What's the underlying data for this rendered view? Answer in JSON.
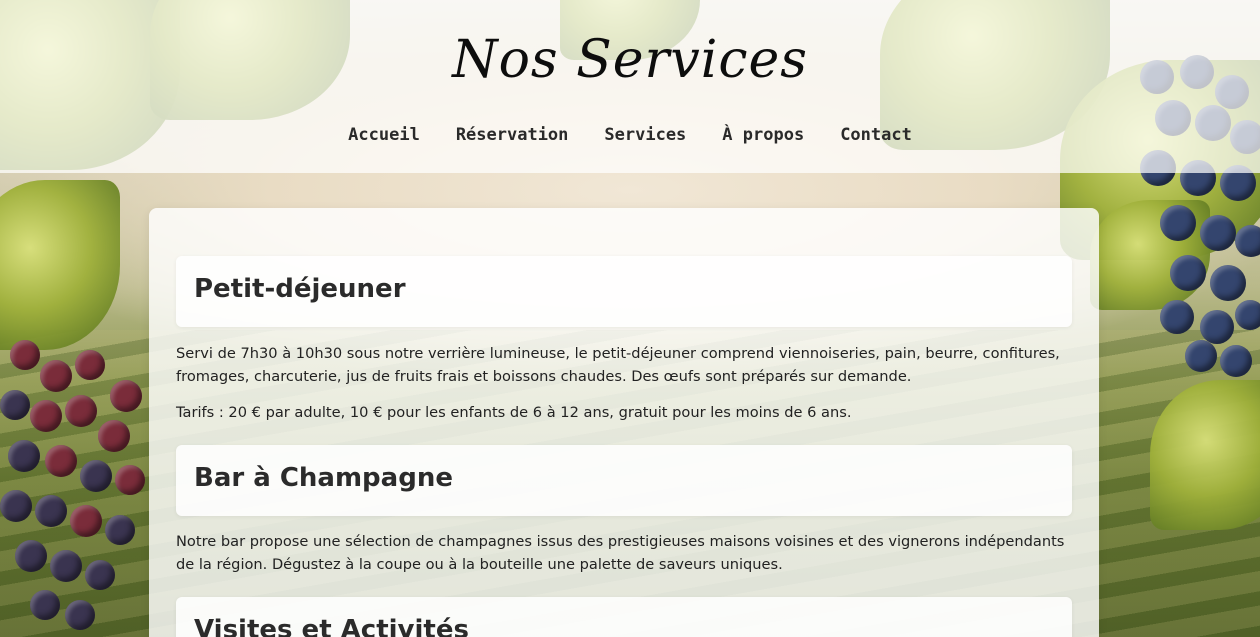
{
  "header": {
    "title": "Nos Services",
    "nav": [
      {
        "label": "Accueil"
      },
      {
        "label": "Réservation"
      },
      {
        "label": "Services"
      },
      {
        "label": "À propos"
      },
      {
        "label": "Contact"
      }
    ]
  },
  "sections": [
    {
      "title": "Petit-déjeuner",
      "paragraphs": [
        "Servi de 7h30 à 10h30 sous notre verrière lumineuse, le petit-déjeuner comprend viennoiseries, pain, beurre, confitures, fromages, charcuterie, jus de fruits frais et boissons chaudes. Des œufs sont préparés sur demande.",
        "Tarifs : 20 € par adulte, 10 € pour les enfants de 6 à 12 ans, gratuit pour les moins de 6 ans."
      ]
    },
    {
      "title": "Bar à Champagne",
      "paragraphs": [
        "Notre bar propose une sélection de champagnes issus des prestigieuses maisons voisines et des vignerons indépendants de la région. Dégustez à la coupe ou à la bouteille une palette de saveurs uniques."
      ]
    },
    {
      "title": "Visites et Activités",
      "paragraphs": []
    }
  ],
  "colors": {
    "header_overlay": "#ffffff",
    "text": "#222222",
    "heading": "#2b2b2b"
  }
}
